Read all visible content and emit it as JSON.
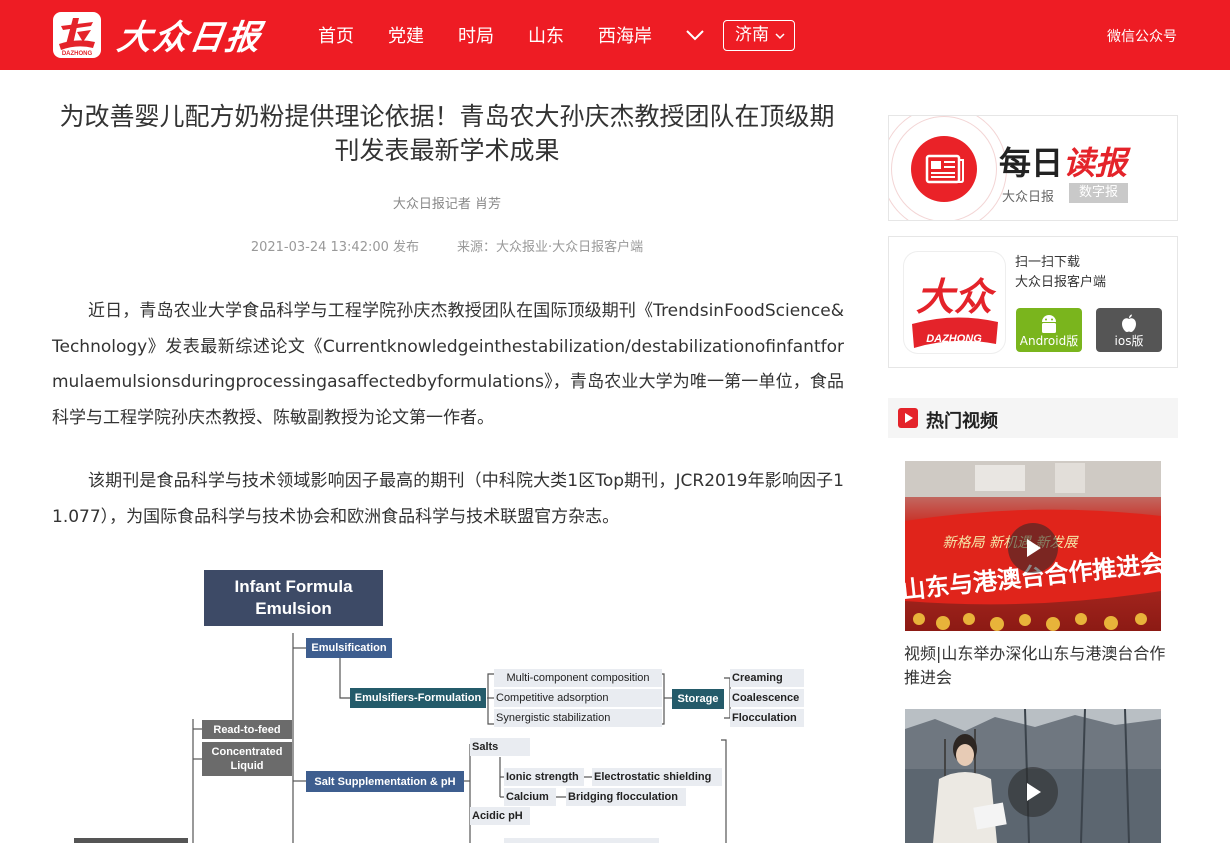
{
  "header": {
    "brand_name": "大众日报",
    "nav": [
      "首页",
      "党建",
      "时局",
      "山东",
      "西海岸"
    ],
    "city": "济南",
    "wechat": "微信公众号",
    "logo_small_text": "DAZHONG",
    "colors": {
      "brand_red": "#ee1c24"
    }
  },
  "article": {
    "title": "为改善婴儿配方奶粉提供理论依据！青岛农大孙庆杰教授团队在顶级期刊发表最新学术成果",
    "byline": "大众日报记者 肖芳",
    "published": "2021-03-24 13:42:00 发布",
    "source": "来源：大众报业·大众日报客户端",
    "paragraphs": [
      "近日，青岛农业大学食品科学与工程学院孙庆杰教授团队在国际顶级期刊《TrendsinFoodScience&Technology》发表最新综述论文《Currentknowledgeinthestabilization/destabilizationofinfantformulaemulsionsduringprocessingasaffectedbyformulations》，青岛农业大学为唯一第一单位，食品科学与工程学院孙庆杰教授、陈敏副教授为论文第一作者。",
      "该期刊是食品科学与技术领域影响因子最高的期刊（中科院大类1区Top期刊，JCR2019年影响因子11.077），为国际食品科学与技术协会和欧洲食品科学与技术联盟官方杂志。"
    ]
  },
  "diagram": {
    "root": "Infant Formula Emulsion",
    "emulsification": "Emulsification",
    "emulsifiers": "Emulsifiers-Formulation",
    "mechanisms": [
      "Multi-component composition",
      "Competitive adsorption",
      "Synergistic stabilization"
    ],
    "storage": "Storage",
    "storage_outcomes": [
      "Creaming",
      "Coalescence",
      "Flocculation"
    ],
    "formats": [
      "Read-to-feed",
      "Concentrated Liquid"
    ],
    "salt": "Salt Supplementation & pH",
    "salts": "Salts",
    "ionic": "Ionic strength",
    "electro": "Electrostatic shielding",
    "calcium": "Calcium",
    "bridging": "Bridging flocculation",
    "acidic": "Acidic pH"
  },
  "sidebar": {
    "daily": {
      "title_a": "每日",
      "title_b": "读报",
      "sub": "大众日报",
      "tag": "数字报"
    },
    "app": {
      "logo_text": "大众",
      "logo_sub": "DAZHONG",
      "scan": "扫一扫下载",
      "client": "大众日报客户端",
      "android": "Android版",
      "ios": "ios版"
    },
    "hot": {
      "title": "热门视频",
      "videos": [
        {
          "caption": "视频|山东举办深化山东与港澳台合作推进会",
          "banner_text": "山东与港澳台合作推进会",
          "banner_top": "新格局 新机遇 新发展"
        }
      ]
    }
  }
}
